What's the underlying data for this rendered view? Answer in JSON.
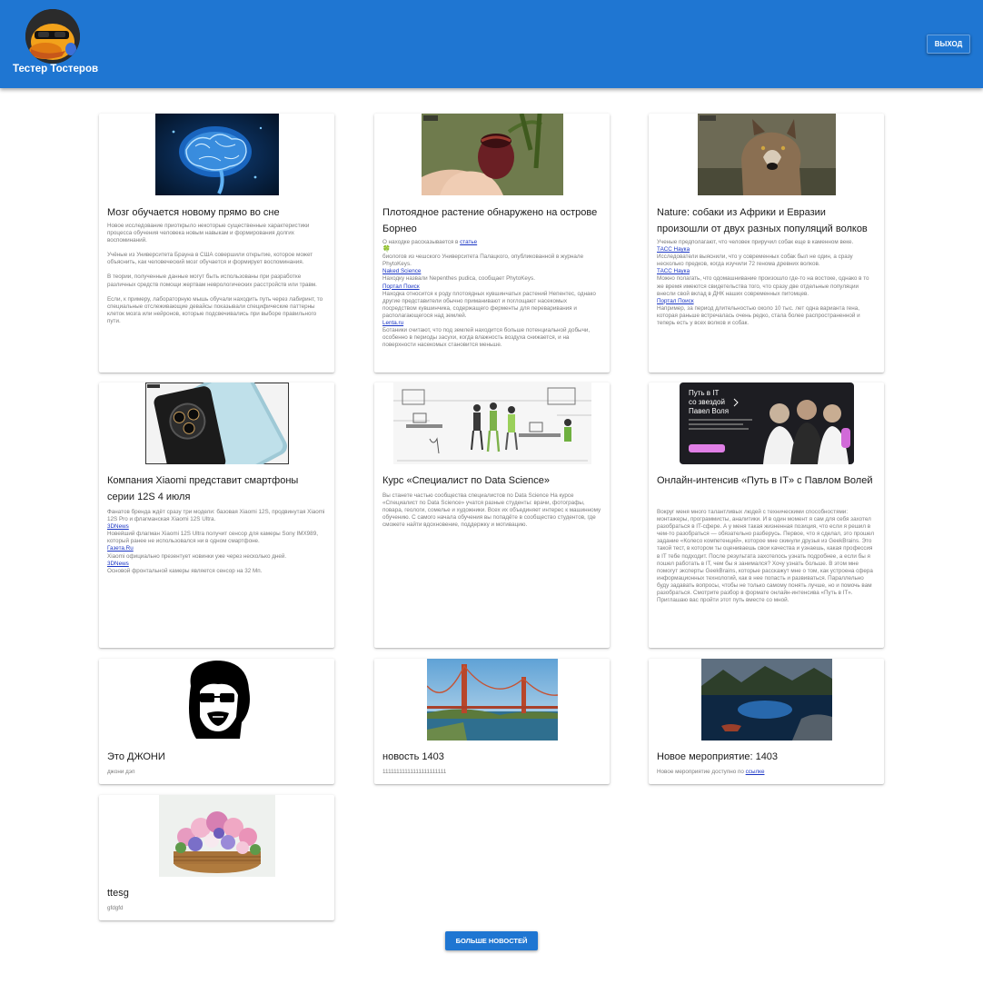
{
  "header": {
    "username": "Тестер Тостеров",
    "logout_label": "ВЫХОД"
  },
  "cards": [
    {
      "title": "Мозг обучается новому прямо во сне",
      "paragraphs": [
        "Новое исследование приоткрыло некоторые существенные характеристики процесса обучения человека новым навыкам и формирования долгих воспоминаний.",
        "Учёные из Университета Брауна в США совершили открытие, которое может объяснить, как человеческий мозг обучается и формирует воспоминания.",
        "В теории, полученные данные могут быть использованы при разработке различных средств помощи жертвам неврологических расстройств или травм.",
        "Если, к примеру, лабораторную мышь обучали находить путь через лабиринт, то специальные отслеживающие девайсы показывали специфические паттерны клеток мозга или нейронов, которые подсвечивались при выборе правильного пути."
      ],
      "image_icon": "brain-image"
    },
    {
      "title": "Плотоядное растение обнаружено на острове Борнео",
      "intro": "О находке рассказывается в",
      "intro_link": "статье",
      "clover": "🍀",
      "text1": " биологов из чешского Университета Палацкого, опубликованной в журнале PhytoKeys.",
      "link1": "Naked Science",
      "text2": "Находку назвали Nepenthes pudica, сообщает PhytoKeys.",
      "link2": "Портал Поиск",
      "text3": "Находка относится к роду плотоядных кувшинчатых растений Непентес, однако другие представители обычно приманивают и поглощают насекомых посредством кувшинчика, содержащего ферменты для переваривания и располагающегося над землей.",
      "link3": "Lenta.ru",
      "text4": "Ботаники считают, что под землей находится больше потенциальной добычи, особенно в периоды засухи, когда влажность воздуха снижается, и на поверхности насекомых становится меньше.",
      "image_icon": "pitcher-plant-image"
    },
    {
      "title": "Nature: собаки из Африки и Евразии произошли от двух разных популяций волков",
      "text1": "Ученые предполагают, что человек приручил собак еще в каменном веке.",
      "link1": "ТАСС Наука",
      "text2": "Исследователи выяснили, что у современных собак был не один, а сразу несколько предков, когда изучили 72 генома древних волков.",
      "link2": "ТАСС Наука",
      "text3": "Можно полагать, что одомашнивание произошло где-то на востоке, однако в то же время имеются свидетельства того, что сразу две отдельные популяции внесли свой вклад в ДНК наших современных питомцев.",
      "link3": "Портал Поиск",
      "text4": "Например, за период длительностью около 10 тыс. лет одна вариантa гена, которая раньше встречалась очень редко, стала более распространенной и теперь есть у всех волков и собак.",
      "image_icon": "wolf-image"
    },
    {
      "title": "Компания Xiaomi представит смартфоны серии 12S 4 июля",
      "text1": "Фанатов бренда ждёт сразу три модели: базовая Xiaomi 12S, продвинутая Xiaomi 12S Pro и флагманская Xiaomi 12S Ultra.",
      "link1": "3DNews",
      "text2": "Новейший флагман Xiaomi 12S Ultra получит сенсор для камеры Sony IMX989, который ранее не использовался ни в одном смартфоне.",
      "link2": "Газета.Ru",
      "text3": "Xiaomi официально презентует новинки уже через несколько дней.",
      "link3": "3DNews",
      "text4": "Основой фронтальной камеры является сенсор на 32 Мп.",
      "image_icon": "smartphone-image"
    },
    {
      "title": "Курс «Специалист по Data Science»",
      "text": "Вы станете частью сообщества специалистов по Data Science На курсе «Специалист по Data Science» учатся разные студенты: врачи, фотографы, повара, геологи, сомелье и художники. Всех их объединяет интерес к машинному обучению. С самого начала обучения вы попадёте в сообщество студентов, где сможете найти вдохновение, поддержку и мотивацию.",
      "image_icon": "office-illustration-image"
    },
    {
      "title": "Онлайн-интенсив «Путь в IT» с Павлом Волей",
      "text": "Вокруг меня много талантливых людей с техническими способностями: монтажеры, программисты, аналитики. И в один момент я сам для себя захотел разобраться в IT-сфере. А у меня такая жизненная позиция, что если я решил в чем-то разобраться — обязательно разберусь. Первое, что я сделал, это прошел задание «Колесо компетенций», которое мне скинули  друзья из GeekBrains. Это такой тест, в котором ты оцениваешь свои качества и узнаешь, какая профессия в IT тебе подходит. После результата захотелось узнать подробнее, а если бы я пошел работать в IT, чем бы я занимался? Хочу узнать больше. В этом мне помогут эксперты GeekBrains, которые расскажут мне о том, как устроена сфера информационных технологий, как в нее попасть и развиваться. Параллельно буду задавать вопросы, чтобы не только самому понять лучше, но и помочь вам разобраться. Смотрите разбор в формате онлайн-интенсива «Путь в IT». Приглашаю вас пройти этот путь вместе со мной.",
      "image_icon": "banner-image",
      "banner_line1": "Путь в IT",
      "banner_line2": "со звездой",
      "banner_line3": "Павел Воля"
    },
    {
      "title": "Это ДЖОНИ",
      "text": "джони дэп",
      "image_icon": "portrait-stencil-image"
    },
    {
      "title": "новость 1403",
      "text": "11111111111111111111111",
      "image_icon": "bridge-image"
    },
    {
      "title": "Новое мероприятие: 1403",
      "text": "Новое мероприятие доступно по",
      "link": "ссылке",
      "image_icon": "lake-image"
    },
    {
      "title": "ttesg",
      "text": "gfdgfd",
      "image_icon": "flower-basket-image"
    }
  ],
  "footer": {
    "more_label": "БОЛЬШЕ НОВОСТЕЙ"
  },
  "colors": {
    "primary": "#1f76d2",
    "link": "#1a35c4",
    "muted_text": "#7b7b7b"
  }
}
